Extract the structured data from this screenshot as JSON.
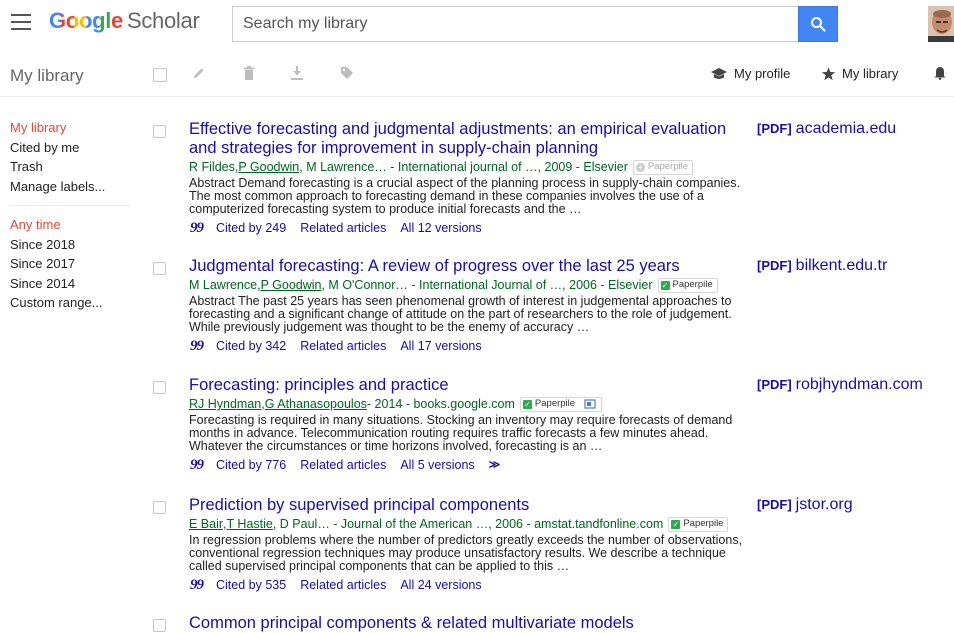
{
  "header": {
    "logo_google": "Google",
    "logo_scholar": "Scholar",
    "search_placeholder": "Search my library"
  },
  "toolbar": {
    "title": "My library",
    "my_profile": "My profile",
    "my_library": "My library"
  },
  "sidebar": {
    "items": [
      "My library",
      "Cited by me",
      "Trash",
      "Manage labels..."
    ],
    "time_filters": [
      "Any time",
      "Since 2018",
      "Since 2017",
      "Since 2014",
      "Custom range..."
    ]
  },
  "results": [
    {
      "title": "Effective forecasting and judgmental adjustments: an empirical evaluation and strategies for improvement in supply-chain planning",
      "authors_pre": "R Fildes, ",
      "authors_u1": "P Goodwin",
      "authors_post": ", M Lawrence… - International journal of …, 2009 - Elsevier",
      "paperpile": "Paperpile",
      "snippet": "Abstract Demand forecasting is a crucial aspect of the planning process in supply-chain companies. The most common approach to forecasting demand in these companies involves the use of a computerized forecasting system to produce initial forecasts and the …",
      "cited_by": "Cited by 249",
      "related": "Related articles",
      "versions": "All 12 versions",
      "pdf_tag": "[PDF]",
      "pdf_source": "academia.edu"
    },
    {
      "title": "Judgmental forecasting: A review of progress over the last 25 years",
      "authors_pre": "M Lawrence, ",
      "authors_u1": "P Goodwin",
      "authors_post": ", M O'Connor… - International Journal of …, 2006 - Elsevier",
      "paperpile": "Paperpile",
      "snippet": "Abstract The past 25 years has seen phenomenal growth of interest in judgemental approaches to forecasting and a significant change of attitude on the part of researchers to the role of judgement. While previously judgement was thought to be the enemy of accuracy …",
      "cited_by": "Cited by 342",
      "related": "Related articles",
      "versions": "All 17 versions",
      "pdf_tag": "[PDF]",
      "pdf_source": "bilkent.edu.tr"
    },
    {
      "title": "Forecasting: principles and practice",
      "authors_u1": "RJ Hyndman",
      "authors_mid": ", ",
      "authors_u2": "G Athanasopoulos",
      "authors_post": " - 2014 - books.google.com",
      "paperpile": "Paperpile",
      "snippet": "Forecasting is required in many situations. Stocking an inventory may require forecasts of demand months in advance. Telecommunication routing requires traffic forecasts a few minutes ahead. Whatever the circumstances or time horizons involved, forecasting is an …",
      "cited_by": "Cited by 776",
      "related": "Related articles",
      "versions": "All 5 versions",
      "more": "≫",
      "pdf_tag": "[PDF]",
      "pdf_source": "robjhyndman.com"
    },
    {
      "title": "Prediction by supervised principal components",
      "authors_u1": "E Bair",
      "authors_mid": ", ",
      "authors_u2": "T Hastie",
      "authors_post": ", D Paul… - Journal of the American …, 2006 - amstat.tandfonline.com",
      "paperpile": "Paperpile",
      "snippet": "In regression problems where the number of predictors greatly exceeds the number of observations, conventional regression techniques may produce unsatisfactory results. We describe a technique called supervised principal components that can be applied to this …",
      "cited_by": "Cited by 535",
      "related": "Related articles",
      "versions": "All 24 versions",
      "pdf_tag": "[PDF]",
      "pdf_source": "jstor.org"
    },
    {
      "title": "Common principal components & related multivariate models"
    }
  ],
  "colors": {
    "accent_blue": "#4285f4",
    "link_blue": "#1a0dab",
    "green": "#006621",
    "active_red": "#dd4b39"
  }
}
